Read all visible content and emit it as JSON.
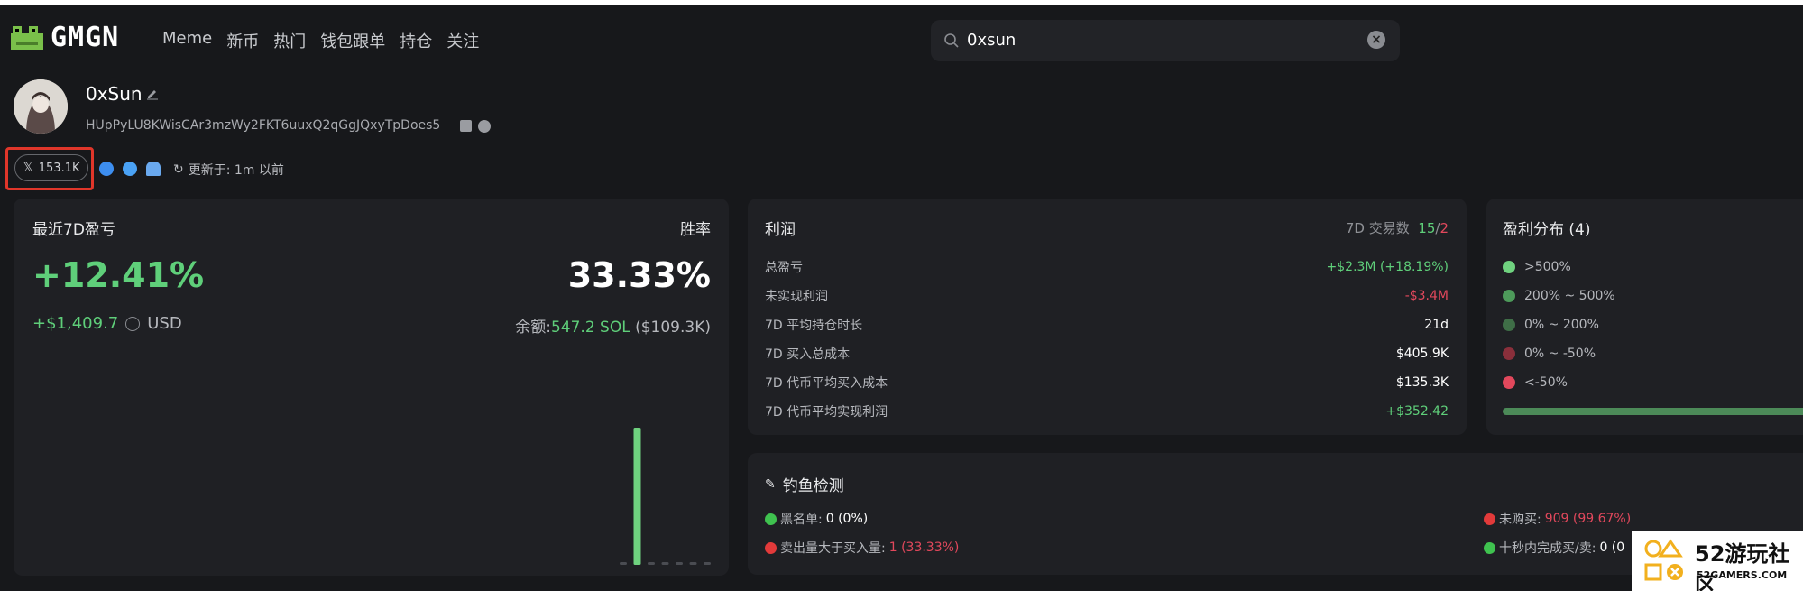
{
  "header": {
    "logo_text": "GMGN",
    "nav": [
      "Meme",
      "新币",
      "热门",
      "钱包跟单",
      "持仓",
      "关注"
    ],
    "search_value": "0xsun"
  },
  "profile": {
    "name": "0xSun",
    "address": "HUpPyLU8KWisCAr3mzWy2FKT6uuxQ2qGgJQxyTpDoes5",
    "x_followers": "153.1K",
    "updated": "更新于: 1m 以前"
  },
  "pnl_card": {
    "label_left": "最近7D盈亏",
    "label_right": "胜率",
    "pnl_pct": "+12.41%",
    "win_rate": "33.33%",
    "pnl_usd": "+$1,409.7",
    "currency": "USD",
    "balance_label": "余额:",
    "balance_sol": "547.2 SOL",
    "balance_usd": "($109.3K)"
  },
  "chart_data": {
    "type": "bar",
    "values": [
      0.02,
      1,
      0.02,
      0.02,
      0.02,
      0.02,
      0.02
    ]
  },
  "profit": {
    "title": "利润",
    "tx_label": "7D 交易数",
    "tx_win": "15",
    "tx_sep": "/",
    "tx_loss": "2",
    "rows": [
      {
        "k": "总盈亏",
        "v": "+$2.3M (+18.19%)",
        "color": "green"
      },
      {
        "k": "未实现利润",
        "v": "-$3.4M",
        "color": "red"
      },
      {
        "k": "7D 平均持仓时长",
        "v": "21d",
        "color": "white"
      },
      {
        "k": "7D 买入总成本",
        "v": "$405.9K",
        "color": "white"
      },
      {
        "k": "7D 代币平均买入成本",
        "v": "$135.3K",
        "color": "white"
      },
      {
        "k": "7D 代币平均实现利润",
        "v": "+$352.42",
        "color": "green"
      }
    ]
  },
  "distribution": {
    "title": "盈利分布 (4)",
    "items": [
      {
        "label": ">500%",
        "color": "#6fd27f"
      },
      {
        "label": "200% ~ 500%",
        "color": "#4d9a5a"
      },
      {
        "label": "0% ~ 200%",
        "color": "#3f6e47"
      },
      {
        "label": "0% ~ -50%",
        "color": "#8a2f3b"
      },
      {
        "label": "<-50%",
        "color": "#e2485c"
      }
    ]
  },
  "phishing": {
    "title": "钓鱼检测",
    "blacklist_label": "黑名单:",
    "blacklist_value": "0 (0%)",
    "sell_gt_buy_label": "卖出量大于买入量:",
    "sell_gt_buy_value": "1 (33.33%)",
    "not_bought_label": "未购买:",
    "not_bought_value": "909 (99.67%)",
    "fast_trade_label": "十秒内完成买/卖:",
    "fast_trade_value": "0 (0"
  },
  "watermark": {
    "text": "52游玩社区",
    "sub": "52GAMERS.COM"
  }
}
